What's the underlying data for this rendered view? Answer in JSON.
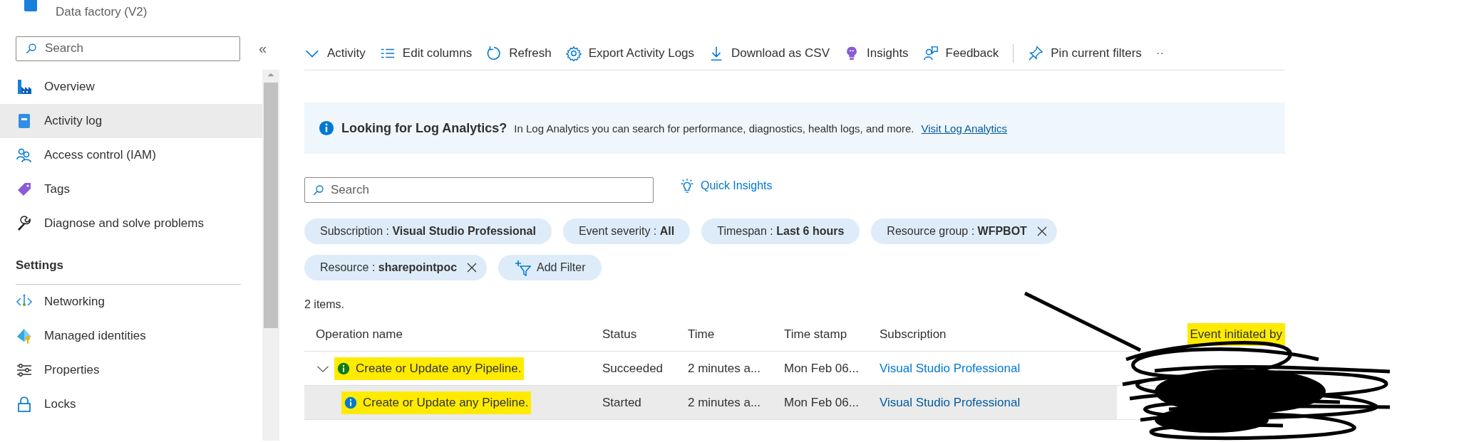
{
  "resource": {
    "subtitle": "Data factory (V2)"
  },
  "sidebar": {
    "search": {
      "placeholder": "Search"
    },
    "collapse": "«",
    "items": [
      {
        "label": "Overview",
        "selected": false
      },
      {
        "label": "Activity log",
        "selected": true
      },
      {
        "label": "Access control (IAM)",
        "selected": false
      },
      {
        "label": "Tags",
        "selected": false
      },
      {
        "label": "Diagnose and solve problems",
        "selected": false
      }
    ],
    "sections": [
      {
        "heading": "Settings",
        "items": [
          {
            "label": "Networking",
            "selected": false
          },
          {
            "label": "Managed identities",
            "selected": false
          },
          {
            "label": "Properties",
            "selected": false
          },
          {
            "label": "Locks",
            "selected": false
          }
        ]
      }
    ]
  },
  "toolbar": {
    "items": [
      {
        "label": "Activity",
        "separator_before": false
      },
      {
        "label": "Edit columns",
        "separator_before": false
      },
      {
        "label": "Refresh",
        "separator_before": false
      },
      {
        "label": "Export Activity Logs",
        "separator_before": false
      },
      {
        "label": "Download as CSV",
        "separator_before": false
      },
      {
        "label": "Insights",
        "separator_before": false
      },
      {
        "label": "Feedback",
        "separator_before": false
      },
      {
        "label": "Pin current filters",
        "separator_before": true
      }
    ],
    "more": "··"
  },
  "banner": {
    "title": "Looking for Log Analytics?",
    "text": "In Log Analytics you can search for performance, diagnostics, health logs, and more.",
    "link": "Visit Log Analytics"
  },
  "filters": {
    "search": {
      "placeholder": "Search"
    },
    "quick_insights": "Quick Insights",
    "pills": [
      {
        "label": "Subscription :",
        "value": "Visual Studio Professional",
        "removable": false
      },
      {
        "label": "Event severity :",
        "value": "All",
        "removable": false
      },
      {
        "label": "Timespan :",
        "value": "Last 6 hours",
        "removable": false
      },
      {
        "label": "Resource group :",
        "value": "WFPBOT",
        "removable": true
      },
      {
        "label": "Resource :",
        "value": "sharepointpoc",
        "removable": true
      }
    ],
    "add_filter": "Add Filter"
  },
  "item_count": "2 items.",
  "table": {
    "columns": [
      {
        "label": "Operation name",
        "highlighted": false
      },
      {
        "label": "Status",
        "highlighted": false
      },
      {
        "label": "Time",
        "highlighted": false
      },
      {
        "label": "Time stamp",
        "highlighted": false
      },
      {
        "label": "Subscription",
        "highlighted": false
      },
      {
        "label": "Event initiated by",
        "highlighted": true
      }
    ],
    "rows": [
      {
        "operation": "Create or Update any Pipeline.",
        "color": "#107c10",
        "status": "Succeeded",
        "time": "2 minutes a...",
        "timestamp": "Mon Feb 06...",
        "subscription": "Visual Studio Professional",
        "selected": false,
        "highlighted": true,
        "expanded": true,
        "children": [
          {
            "operation": "Create or Update any Pipeline.",
            "color": "#0078d4",
            "status": "Started",
            "time": "2 minutes a...",
            "timestamp": "Mon Feb 06...",
            "subscription": "Visual Studio Professional",
            "selected": true,
            "highlighted": true
          }
        ]
      }
    ]
  }
}
